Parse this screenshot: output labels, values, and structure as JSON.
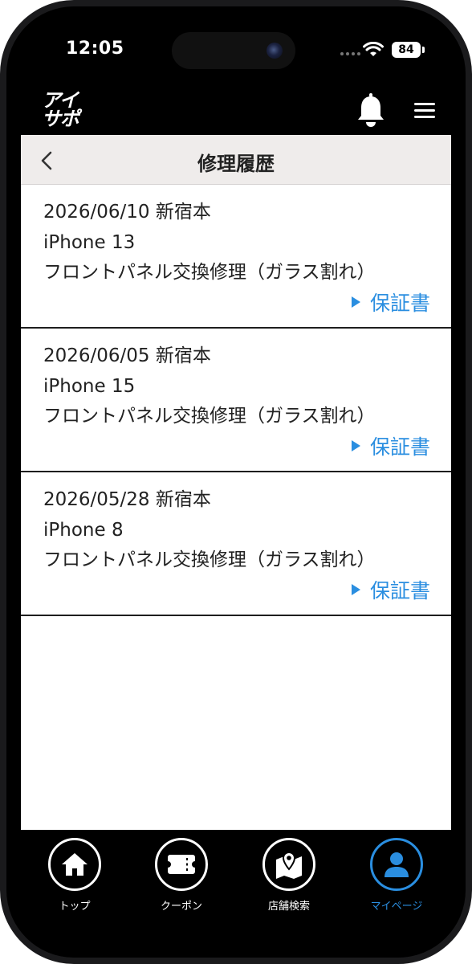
{
  "status_bar": {
    "time": "12:05",
    "battery": "84"
  },
  "header": {
    "logo_line1": "アイ",
    "logo_line2": "サポ"
  },
  "page": {
    "title": "修理履歴"
  },
  "records": [
    {
      "date_store": "2026/06/10 新宿本",
      "device": "iPhone 13",
      "service": "フロントパネル交換修理（ガラス割れ）",
      "warranty_label": "保証書"
    },
    {
      "date_store": "2026/06/05 新宿本",
      "device": "iPhone 15",
      "service": "フロントパネル交換修理（ガラス割れ）",
      "warranty_label": "保証書"
    },
    {
      "date_store": "2026/05/28 新宿本",
      "device": "iPhone 8",
      "service": "フロントパネル交換修理（ガラス割れ）",
      "warranty_label": "保証書"
    }
  ],
  "nav": {
    "items": [
      {
        "label": "トップ",
        "icon": "home-icon"
      },
      {
        "label": "クーポン",
        "icon": "ticket-icon"
      },
      {
        "label": "店舗検索",
        "icon": "map-pin-icon"
      },
      {
        "label": "マイページ",
        "icon": "user-icon",
        "active": true
      }
    ]
  },
  "colors": {
    "accent": "#2a8ee0",
    "title_bar_bg": "#efeceb",
    "background": "#000000"
  }
}
